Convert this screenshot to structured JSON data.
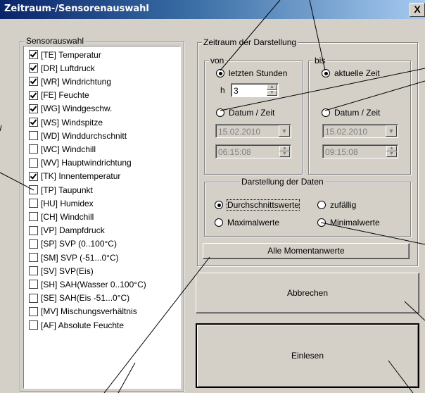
{
  "window": {
    "title": "Zeitraum-/Sensorenauswahl",
    "close_label": "X"
  },
  "sensor_group": {
    "label": "Sensorauswahl",
    "items": [
      {
        "label": "[TE] Temperatur",
        "checked": true
      },
      {
        "label": "[DR] Luftdruck",
        "checked": true
      },
      {
        "label": "[WR] Windrichtung",
        "checked": true
      },
      {
        "label": "[FE] Feuchte",
        "checked": true
      },
      {
        "label": "[WG] Windgeschw.",
        "checked": true
      },
      {
        "label": "[WS] Windspitze",
        "checked": true
      },
      {
        "label": "[WD] Winddurchschnitt",
        "checked": false
      },
      {
        "label": "[WC] Windchill",
        "checked": false
      },
      {
        "label": "[WV] Hauptwindrichtung",
        "checked": false
      },
      {
        "label": "[TK] Innentemperatur",
        "checked": true
      },
      {
        "label": "[TP] Taupunkt",
        "checked": false
      },
      {
        "label": "[HU] Humidex",
        "checked": false
      },
      {
        "label": "[CH] Windchill",
        "checked": false
      },
      {
        "label": "[VP] Dampfdruck",
        "checked": false
      },
      {
        "label": "[SP] SVP (0..100°C)",
        "checked": false
      },
      {
        "label": "[SM] SVP (-51...0°C)",
        "checked": false
      },
      {
        "label": "[SV] SVP(Eis)",
        "checked": false
      },
      {
        "label": "[SH] SAH(Wasser 0..100°C)",
        "checked": false
      },
      {
        "label": "[SE] SAH(Eis -51...0°C)",
        "checked": false
      },
      {
        "label": "[MV] Mischungsverhältnis",
        "checked": false
      },
      {
        "label": "[AF] Absolute Feuchte",
        "checked": false
      }
    ]
  },
  "period_group": {
    "label": "Zeitraum der Darstellung",
    "von": {
      "label": "von",
      "last_hours_label": "letzten Stunden",
      "last_hours_selected": true,
      "hours_prefix": "h",
      "hours_value": "3",
      "datetime_label": "Datum / Zeit",
      "datetime_selected": false,
      "date_value": "15.02.2010",
      "time_value": "06:15:08"
    },
    "bis": {
      "label": "bis",
      "current_time_label": "aktuelle Zeit",
      "current_time_selected": true,
      "datetime_label": "Datum / Zeit",
      "datetime_selected": false,
      "date_value": "15.02.2010",
      "time_value": "09:15:08"
    }
  },
  "display_group": {
    "label": "Darstellung der Daten",
    "options": {
      "average": {
        "label": "Durchschnittswerte",
        "selected": true
      },
      "random": {
        "label": "zufällig",
        "selected": false
      },
      "max": {
        "label": "Maximalwerte",
        "selected": false
      },
      "min": {
        "label": "Minimalwerte",
        "selected": false
      }
    }
  },
  "buttons": {
    "all_current": "Alle Momentanwerte",
    "cancel": "Abbrechen",
    "load": "Einlesen"
  },
  "colors": {
    "title_start": "#0a246a",
    "title_end": "#a6caf0",
    "face": "#d4d0c8",
    "annotation_line": "#000000"
  }
}
